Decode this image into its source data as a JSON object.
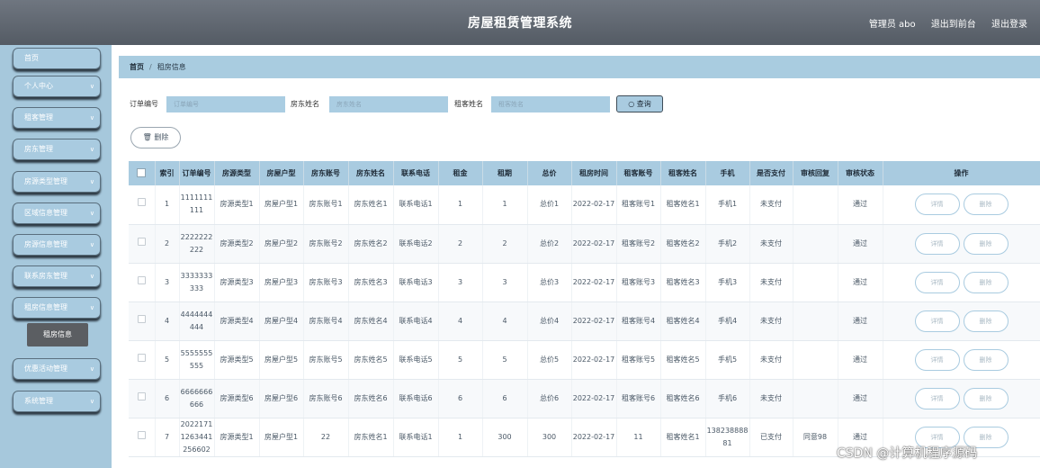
{
  "header": {
    "title": "房屋租赁管理系统",
    "user": "管理员 abo",
    "back_front": "退出到前台",
    "logout": "退出登录"
  },
  "sidebar": {
    "items": [
      {
        "label": "首页",
        "has_chevron": false
      },
      {
        "label": "个人中心",
        "has_chevron": true
      },
      {
        "label": "租客管理",
        "has_chevron": true
      },
      {
        "label": "房东管理",
        "has_chevron": true
      },
      {
        "label": "房源类型管理",
        "has_chevron": true
      },
      {
        "label": "区域信息管理",
        "has_chevron": true
      },
      {
        "label": "房源信息管理",
        "has_chevron": true
      },
      {
        "label": "联系房东管理",
        "has_chevron": true
      },
      {
        "label": "租房信息管理",
        "has_chevron": true
      },
      {
        "label": "优惠活动管理",
        "has_chevron": true
      },
      {
        "label": "系统管理",
        "has_chevron": true
      }
    ],
    "active_sub": "租房信息"
  },
  "breadcrumb": {
    "home": "首页",
    "current": "租房信息"
  },
  "search": {
    "order_label": "订单编号",
    "order_placeholder": "订单编号",
    "landlord_label": "房东姓名",
    "landlord_placeholder": "房东姓名",
    "tenant_label": "租客姓名",
    "tenant_placeholder": "租客姓名",
    "query_label": "查询"
  },
  "actions": {
    "delete_label": "删除",
    "detail_label": "详情",
    "row_delete_label": "删除"
  },
  "table": {
    "columns": [
      "索引",
      "订单编号",
      "房源类型",
      "房屋户型",
      "房东账号",
      "房东姓名",
      "联系电话",
      "租金",
      "租期",
      "总价",
      "租房时间",
      "租客账号",
      "租客姓名",
      "手机",
      "是否支付",
      "审核回复",
      "审核状态",
      "操作"
    ],
    "rows": [
      [
        "1",
        "1111111111",
        "房源类型1",
        "房屋户型1",
        "房东账号1",
        "房东姓名1",
        "联系电话1",
        "1",
        "1",
        "总价1",
        "2022-02-17",
        "租客账号1",
        "租客姓名1",
        "手机1",
        "未支付",
        "",
        "通过"
      ],
      [
        "2",
        "2222222222",
        "房源类型2",
        "房屋户型2",
        "房东账号2",
        "房东姓名2",
        "联系电话2",
        "2",
        "2",
        "总价2",
        "2022-02-17",
        "租客账号2",
        "租客姓名2",
        "手机2",
        "未支付",
        "",
        "通过"
      ],
      [
        "3",
        "3333333333",
        "房源类型3",
        "房屋户型3",
        "房东账号3",
        "房东姓名3",
        "联系电话3",
        "3",
        "3",
        "总价3",
        "2022-02-17",
        "租客账号3",
        "租客姓名3",
        "手机3",
        "未支付",
        "",
        "通过"
      ],
      [
        "4",
        "4444444444",
        "房源类型4",
        "房屋户型4",
        "房东账号4",
        "房东姓名4",
        "联系电话4",
        "4",
        "4",
        "总价4",
        "2022-02-17",
        "租客账号4",
        "租客姓名4",
        "手机4",
        "未支付",
        "",
        "通过"
      ],
      [
        "5",
        "5555555555",
        "房源类型5",
        "房屋户型5",
        "房东账号5",
        "房东姓名5",
        "联系电话5",
        "5",
        "5",
        "总价5",
        "2022-02-17",
        "租客账号5",
        "租客姓名5",
        "手机5",
        "未支付",
        "",
        "通过"
      ],
      [
        "6",
        "6666666666",
        "房源类型6",
        "房屋户型6",
        "房东账号6",
        "房东姓名6",
        "联系电话6",
        "6",
        "6",
        "总价6",
        "2022-02-17",
        "租客账号6",
        "租客姓名6",
        "手机6",
        "未支付",
        "",
        "通过"
      ],
      [
        "7",
        "20221711263441256602",
        "房源类型1",
        "房屋户型1",
        "22",
        "房东姓名1",
        "联系电话1",
        "1",
        "300",
        "300",
        "2022-02-17",
        "11",
        "租客姓名1",
        "13823888881",
        "已支付",
        "同意98",
        "通过"
      ]
    ]
  },
  "watermark": "CSDN @计算机程序源码",
  "colors": {
    "accent": "#a9cbe0",
    "header": "#5f666f",
    "sidebar": "#a6c8dc",
    "submenu_active": "#5b5e62"
  }
}
